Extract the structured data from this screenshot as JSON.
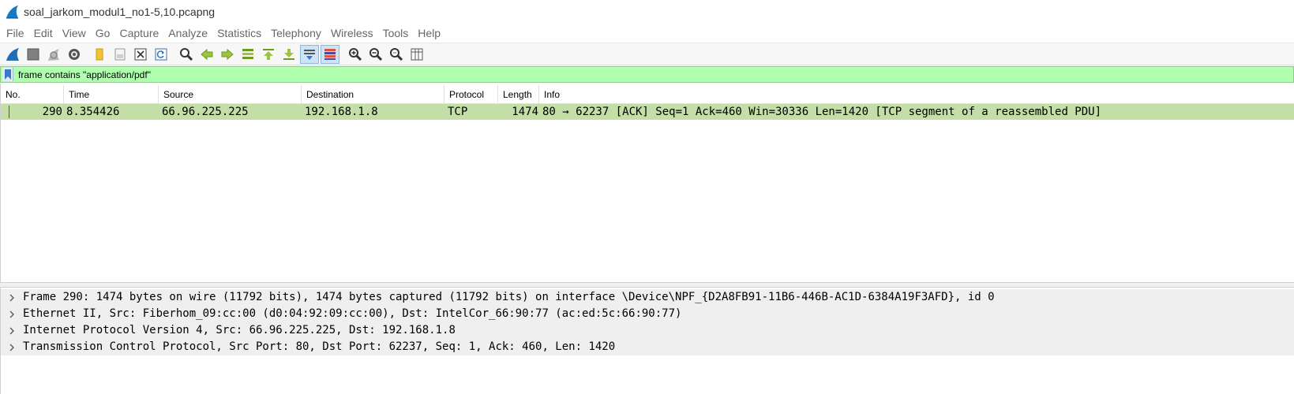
{
  "window": {
    "title": "soal_jarkom_modul1_no1-5,10.pcapng",
    "icon": "wireshark-fin-icon"
  },
  "menu": [
    "File",
    "Edit",
    "View",
    "Go",
    "Capture",
    "Analyze",
    "Statistics",
    "Telephony",
    "Wireless",
    "Tools",
    "Help"
  ],
  "toolbar": {
    "buttons": [
      "start-capture-icon",
      "stop-capture-icon",
      "restart-capture-icon",
      "capture-options-icon",
      "open-file-icon",
      "save-file-icon",
      "close-file-icon",
      "reload-file-icon",
      "find-packet-icon",
      "go-back-icon",
      "go-forward-icon",
      "go-to-packet-icon",
      "first-packet-icon",
      "last-packet-icon",
      "auto-scroll-icon",
      "colorize-icon",
      "zoom-in-icon",
      "zoom-out-icon",
      "normal-size-icon",
      "resize-columns-icon"
    ]
  },
  "filter": {
    "value": "frame contains \"application/pdf\"",
    "background": "#afffaf"
  },
  "packet_list": {
    "columns": [
      "No.",
      "Time",
      "Source",
      "Destination",
      "Protocol",
      "Length",
      "Info"
    ],
    "rows": [
      {
        "no": "290",
        "time": "8.354426",
        "source": "66.96.225.225",
        "destination": "192.168.1.8",
        "protocol": "TCP",
        "length": "1474",
        "info": "80 → 62237 [ACK] Seq=1 Ack=460 Win=30336 Len=1420 [TCP segment of a reassembled PDU]",
        "color": "#c3dea6"
      }
    ]
  },
  "details": {
    "items": [
      "Frame 290: 1474 bytes on wire (11792 bits), 1474 bytes captured (11792 bits) on interface \\Device\\NPF_{D2A8FB91-11B6-446B-AC1D-6384A19F3AFD}, id 0",
      "Ethernet II, Src: Fiberhom_09:cc:00 (d0:04:92:09:cc:00), Dst: IntelCor_66:90:77 (ac:ed:5c:66:90:77)",
      "Internet Protocol Version 4, Src: 66.96.225.225, Dst: 192.168.1.8",
      "Transmission Control Protocol, Src Port: 80, Dst Port: 62237, Seq: 1, Ack: 460, Len: 1420"
    ]
  }
}
